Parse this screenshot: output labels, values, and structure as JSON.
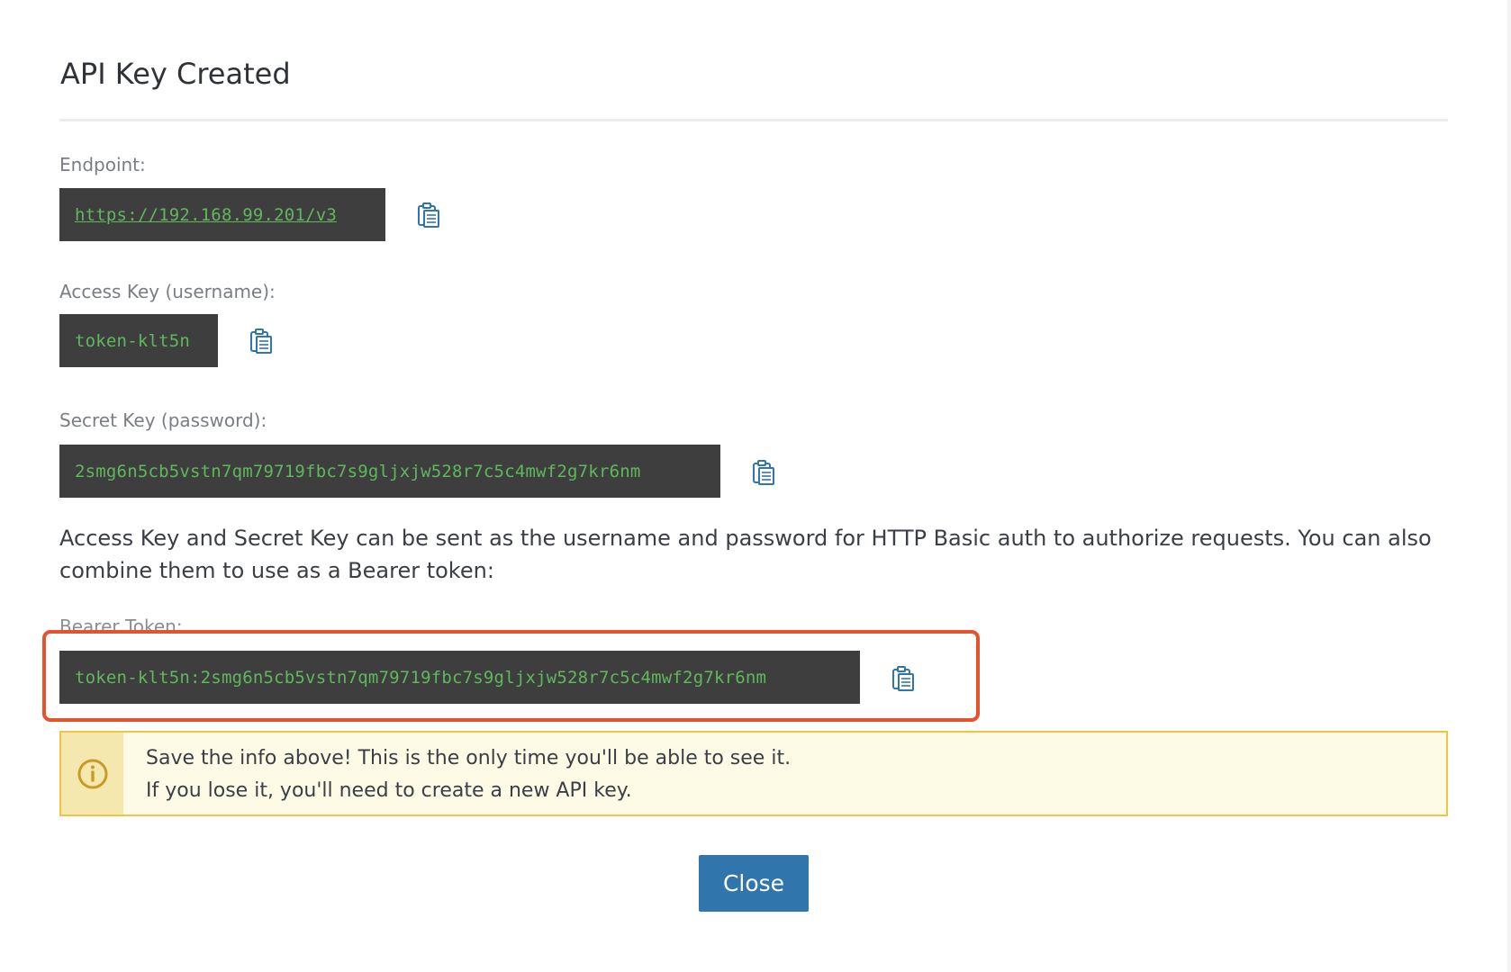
{
  "dialog": {
    "title": "API Key Created"
  },
  "fields": {
    "endpoint": {
      "label": "Endpoint:",
      "value": "https://192.168.99.201/v3"
    },
    "access_key": {
      "label": "Access Key (username):",
      "value": "token-klt5n"
    },
    "secret_key": {
      "label": "Secret Key (password):",
      "value": "2smg6n5cb5vstn7qm79719fbc7s9gljxjw528r7c5c4mwf2g7kr6nm"
    },
    "bearer_token": {
      "label": "Bearer Token:",
      "value": "token-klt5n:2smg6n5cb5vstn7qm79719fbc7s9gljxjw528r7c5c4mwf2g7kr6nm"
    }
  },
  "help_text": "Access Key and Secret Key can be sent as the username and password for HTTP Basic auth to authorize requests. You can also combine them to use as a Bearer token:",
  "alert": {
    "line1": "Save the info above! This is the only time you'll be able to see it.",
    "line2": "If you lose it, you'll need to create a new API key."
  },
  "actions": {
    "close_label": "Close"
  },
  "colors": {
    "code_bg": "#3e3e3e",
    "code_text": "#5fb85c",
    "primary": "#3175ad",
    "highlight": "#e4532e",
    "warning_border": "#f0c544",
    "warning_icon": "#c89b28"
  },
  "icons": {
    "copy": "clipboard-icon",
    "alert": "info-circle-icon"
  }
}
